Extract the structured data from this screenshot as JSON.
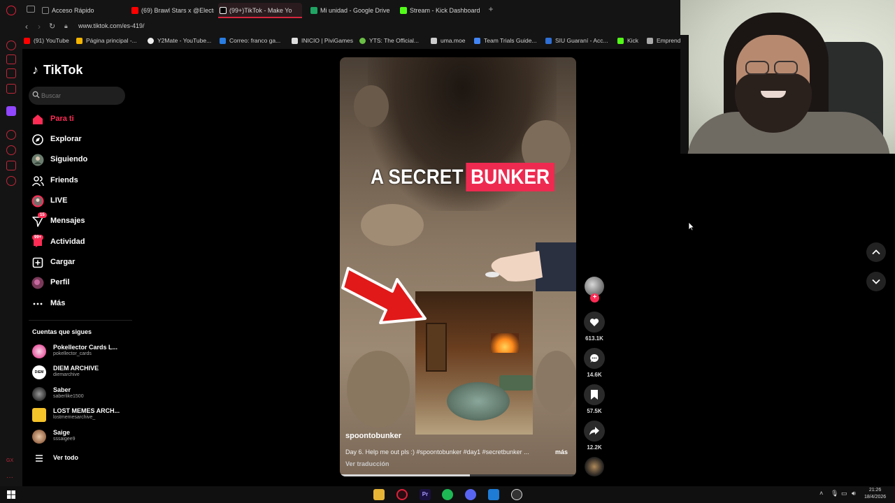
{
  "browser": {
    "tabs": [
      {
        "label": "Acceso Rápido",
        "color": "#888888"
      },
      {
        "label": "(69) Brawl Stars x @Electr",
        "color": "#ff0000"
      },
      {
        "label": "(99+)TikTok - Make Yo",
        "color": "#ffffff"
      },
      {
        "label": "Mi unidad - Google Drive",
        "color": "#1fa463"
      },
      {
        "label": "Stream - Kick Dashboard",
        "color": "#53fc18"
      }
    ],
    "new_tab": "+",
    "url": "www.tiktok.com/es-419/",
    "bookmarks": [
      {
        "label": "(91) YouTube",
        "color": "#ff0000"
      },
      {
        "label": "Página principal -...",
        "color": "#f4b400"
      },
      {
        "label": "Y2Mate - YouTube...",
        "color": "#eeeeee"
      },
      {
        "label": "Correo: franco ga...",
        "color": "#2a7de1"
      },
      {
        "label": "INICIO | PiviGames",
        "color": "#dddddd"
      },
      {
        "label": "YTS: The Official...",
        "color": "#6ac045"
      },
      {
        "label": "uma.moe",
        "color": "#cccccc"
      },
      {
        "label": "Team Trials Guide...",
        "color": "#4285f4"
      },
      {
        "label": "SIU Guaraní - Acc...",
        "color": "#2f6fd6"
      },
      {
        "label": "Kick",
        "color": "#53fc18"
      },
      {
        "label": "Emprend",
        "color": "#aaaaaa"
      }
    ]
  },
  "tiktok": {
    "logo": "TikTok",
    "search_placeholder": "Buscar",
    "nav": [
      {
        "label": "Para ti",
        "icon": "home-icon"
      },
      {
        "label": "Explorar",
        "icon": "compass-icon"
      },
      {
        "label": "Siguiendo",
        "icon": "following-avatar-icon"
      },
      {
        "label": "Friends",
        "icon": "friends-icon"
      },
      {
        "label": "LIVE",
        "icon": "live-icon"
      },
      {
        "label": "Mensajes",
        "icon": "send-icon",
        "badge": "15"
      },
      {
        "label": "Actividad",
        "icon": "inbox-icon",
        "badge": "99+"
      },
      {
        "label": "Cargar",
        "icon": "upload-icon"
      },
      {
        "label": "Perfil",
        "icon": "profile-avatar-icon"
      },
      {
        "label": "Más",
        "icon": "more-icon"
      }
    ],
    "following_title": "Cuentas que sigues",
    "accounts": [
      {
        "name": "Pokellector Cards L...",
        "handle": "pokellector_cards",
        "color": "#e85aa0"
      },
      {
        "name": "DIEM ARCHIVE",
        "handle": "diemarchive",
        "color": "#ffffff"
      },
      {
        "name": "Saber",
        "handle": "saberlike1500",
        "color": "#555555"
      },
      {
        "name": "LOST MEMES ARCH...",
        "handle": "lostmemesarchive_",
        "color": "#f5c32a"
      },
      {
        "name": "Saige",
        "handle": "sssaigee9",
        "color": "#b08060"
      }
    ],
    "see_all": "Ver todo",
    "accent": "#fe2c55"
  },
  "video": {
    "title_plain": "A SECRET",
    "title_highlight": "BUNKER",
    "username": "spoontobunker",
    "description": "Day 6. Help me out pls :) #spoontobunker #day1 #secretbunker ...",
    "more": "más",
    "translate": "Ver traducción",
    "progress": 0.55,
    "likes": "613.1K",
    "comments": "14.6K",
    "saves": "57.5K",
    "shares": "12.2K"
  },
  "taskbar": {
    "time": "21:26",
    "date": "18/4/2026"
  }
}
